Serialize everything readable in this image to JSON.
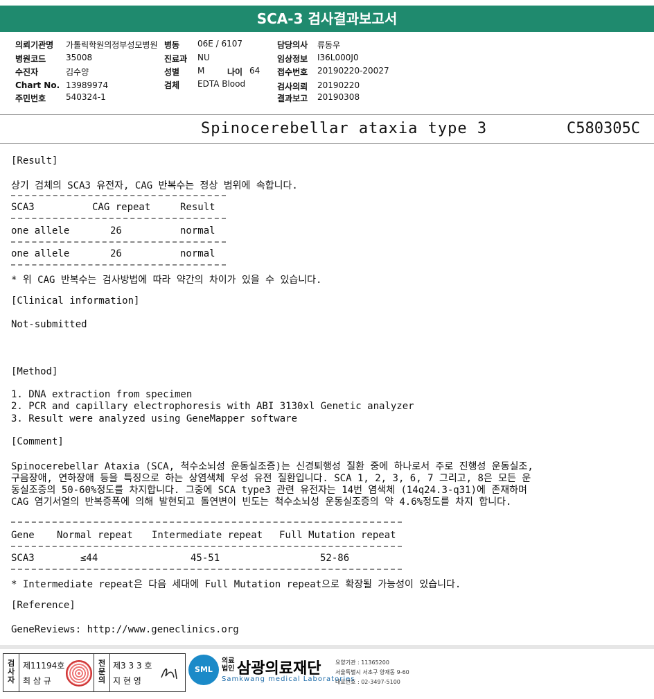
{
  "header": {
    "title": "SCA-3 검사결과보고서"
  },
  "info": {
    "institution_label": "의뢰기관명",
    "institution": "가톨릭학원의정부성모병원",
    "ward_label": "병동",
    "ward": "06E / 6107",
    "doctor_label": "담당의사",
    "doctor": "류동우",
    "hospital_code_label": "병원코드",
    "hospital_code": "35008",
    "dept_label": "진료과",
    "dept": "NU",
    "clinical_label": "임상정보",
    "clinical": "I36L000J0",
    "patient_label": "수진자",
    "patient": "김수양",
    "sex_label": "성별",
    "sex": "M",
    "age_label": "나이",
    "age": "64",
    "receipt_label": "접수번호",
    "receipt": "20190220-20027",
    "chart_label": "Chart No.",
    "chart": "13989974",
    "specimen_label": "검체",
    "specimen": "EDTA Blood",
    "request_label": "검사의뢰",
    "request": "20190220",
    "id_label": "주민번호",
    "id": "540324-1",
    "report_label": "결과보고",
    "report": "20190308"
  },
  "test": {
    "name": "Spinocerebellar ataxia type 3",
    "code": "C580305C"
  },
  "result": {
    "heading": "[Result]",
    "summary": "상기 검체의 SCA3 유전자, CAG 반복수는 정상 범위에 속합니다.",
    "columns": [
      "SCA3",
      "CAG repeat",
      "Result"
    ],
    "rows": [
      [
        "one allele",
        "26",
        "normal"
      ],
      [
        "one allele",
        "26",
        "normal"
      ]
    ],
    "note": "* 위 CAG 반복수는 검사방법에 따라 약간의 차이가 있을 수 있습니다."
  },
  "clinical_info": {
    "heading": "[Clinical information]",
    "text": "Not-submitted"
  },
  "method": {
    "heading": "[Method]",
    "steps": [
      "1. DNA extraction from specimen",
      "2. PCR and capillary electrophoresis with ABI 3130xl Genetic analyzer",
      "3. Result were analyzed using GeneMapper software"
    ]
  },
  "comment": {
    "heading": "[Comment]",
    "lines": [
      "Spinocerebellar Ataxia (SCA, 척수소뇌성 운동실조증)는 신경퇴행성 질환 중에 하나로서 주로 진행성 운동실조,",
      "구음장애, 연하장애 등을 특징으로 하는 상염색체 우성 유전 질환입니다. SCA 1, 2, 3, 6, 7 그리고, 8은 모든 운",
      "동실조증의 50-60%정도를 차지합니다. 그중에 SCA type3 관련 유전자는 14번 염색체 (14q24.3-q31)에 존재하며",
      "CAG 염기서열의 반복증폭에 의해 발현되고 돌연변이 빈도는 척수소뇌성 운동실조증의 약 4.6%정도를 차지 합니다."
    ],
    "table_columns": [
      "Gene",
      "Normal repeat",
      "Intermediate repeat",
      "Full Mutation repeat"
    ],
    "table_row": [
      "SCA3",
      "≤44",
      "45-51",
      "52-86"
    ],
    "note": "* Intermediate repeat은 다음 세대에 Full Mutation repeat으로 확장될 가능성이 있습니다."
  },
  "reference": {
    "heading": "[Reference]",
    "text": "GeneReviews: http://www.geneclinics.org"
  },
  "footer": {
    "examiner_label": "검사자",
    "examiner_no": "제11194호",
    "examiner_name": "최 삼 규",
    "specialist_label": "전문의",
    "specialist_no": "제3 3 3 호",
    "specialist_name": "지 현 영",
    "logo_prefix": "의료법인",
    "lab_name": "삼광의료재단",
    "lab_name_en": "Samkwang medical Laboratories",
    "logo_badge": "SML",
    "addr1": "요양기관 : 11365200",
    "addr2": "서울특별시 서초구 양재동 9-60",
    "addr3": "대표번호 : 02-3497-5100"
  }
}
